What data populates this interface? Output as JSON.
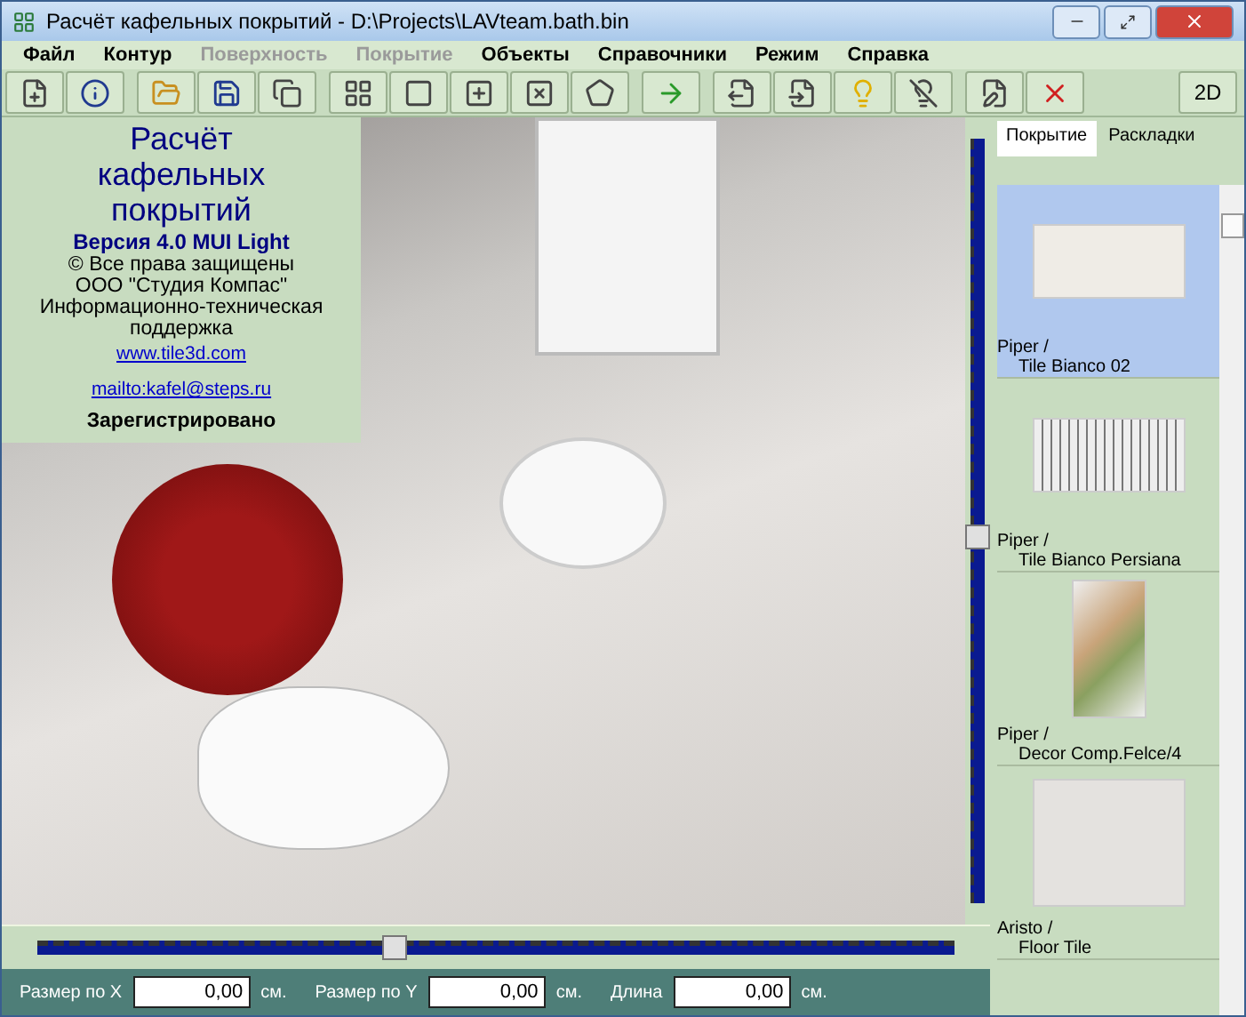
{
  "window": {
    "title": "Расчёт кафельных покрытий - D:\\Projects\\LAVteam.bath.bin"
  },
  "menu": [
    {
      "label": "Файл",
      "disabled": false
    },
    {
      "label": "Контур",
      "disabled": false
    },
    {
      "label": "Поверхность",
      "disabled": true
    },
    {
      "label": "Покрытие",
      "disabled": true
    },
    {
      "label": "Объекты",
      "disabled": false
    },
    {
      "label": "Справочники",
      "disabled": false
    },
    {
      "label": "Режим",
      "disabled": false
    },
    {
      "label": "Справка",
      "disabled": false
    }
  ],
  "toolbar_groups": [
    [
      {
        "kind": "new"
      },
      {
        "kind": "info"
      }
    ],
    [
      {
        "kind": "open"
      },
      {
        "kind": "save"
      },
      {
        "kind": "saveas"
      }
    ],
    [
      {
        "kind": "grid"
      },
      {
        "kind": "rect"
      },
      {
        "kind": "rectplus"
      },
      {
        "kind": "rectx"
      },
      {
        "kind": "shape"
      }
    ],
    [
      {
        "kind": "transfer"
      }
    ],
    [
      {
        "kind": "export"
      },
      {
        "kind": "import"
      },
      {
        "kind": "bulb"
      },
      {
        "kind": "bulboff"
      }
    ],
    [
      {
        "kind": "edit"
      },
      {
        "kind": "close"
      }
    ],
    [
      {
        "kind": "text",
        "label": "2D"
      }
    ]
  ],
  "info": {
    "title": "Расчёт кафельных покрытий",
    "version": "Версия 4.0 MUI Light",
    "lines": [
      "© Все права защищены",
      "ООО \"Студия Компас\"",
      "Информационно-техническая поддержка"
    ],
    "website": "www.tile3d.com",
    "email": "mailto:kafel@steps.ru",
    "status": "Зарегистрировано"
  },
  "vertical_slider": {
    "level": 0.48
  },
  "horizontal_slider": {
    "level": 0.39
  },
  "side_tabs": [
    {
      "label": "Покрытие",
      "selected": true
    },
    {
      "label": "Раскладки",
      "selected": false
    }
  ],
  "tiles": [
    {
      "kind": "plain",
      "brand": "Piper /",
      "name": "Tile Bianco 02",
      "selected": true
    },
    {
      "kind": "striped",
      "brand": "Piper /",
      "name": "Tile Bianco Persiana",
      "selected": false
    },
    {
      "kind": "leaf",
      "brand": "Piper /",
      "name": "Decor Comp.Felce/4",
      "selected": false
    },
    {
      "kind": "speckled",
      "brand": "Aristo /",
      "name": "Floor Tile",
      "selected": false
    }
  ],
  "status_bar": [
    {
      "label": "Размер по X",
      "value": "0,00",
      "unit": "см."
    },
    {
      "label": "Размер по Y",
      "value": "0,00",
      "unit": "см."
    },
    {
      "label": "Длина",
      "value": "0,00",
      "unit": "см."
    }
  ]
}
